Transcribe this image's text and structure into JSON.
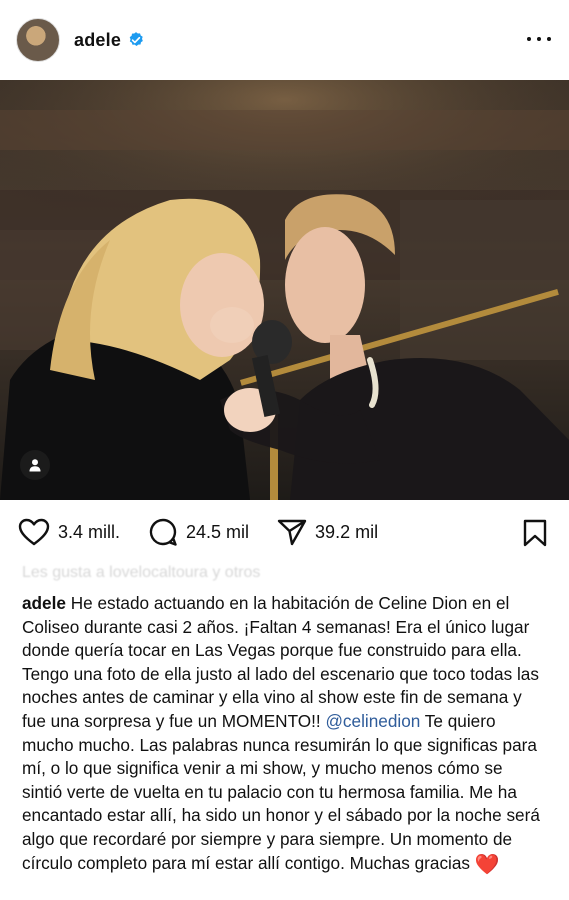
{
  "post": {
    "username": "adele",
    "actions": {
      "likes": "3.4 mill.",
      "comments": "24.5 mil",
      "shares": "39.2 mil"
    },
    "liked_by": "Les gusta a lovelocaltoura y otros",
    "caption": {
      "user": "adele",
      "text_1": "He estado actuando en la habitación de Celine Dion en el Coliseo durante casi 2 años. ¡Faltan 4 semanas! Era el único lugar donde quería tocar en Las Vegas porque fue construido para ella. Tengo una foto de ella justo al lado del escenario que toco todas las noches antes de caminar y ella vino al show este fin de semana y fue una sorpresa y fue un MOMENTO!!",
      "mention": "@celinedion",
      "text_2": "Te quiero mucho mucho. Las palabras nunca resumirán lo que significas para mí, o lo que significa venir a mi show, y mucho menos cómo se sintió verte de vuelta en tu palacio con tu hermosa familia. Me ha encantado estar allí, ha sido un honor y el sábado por la noche será algo que recordaré por siempre y para siempre. Un momento de círculo completo para mí estar allí contigo. Muchas gracias",
      "emoji": "❤️"
    }
  },
  "colors": {
    "verified_blue": "#1d9bf0",
    "mention_blue": "#2f5c9a",
    "heart_red": "#d11a2a"
  }
}
